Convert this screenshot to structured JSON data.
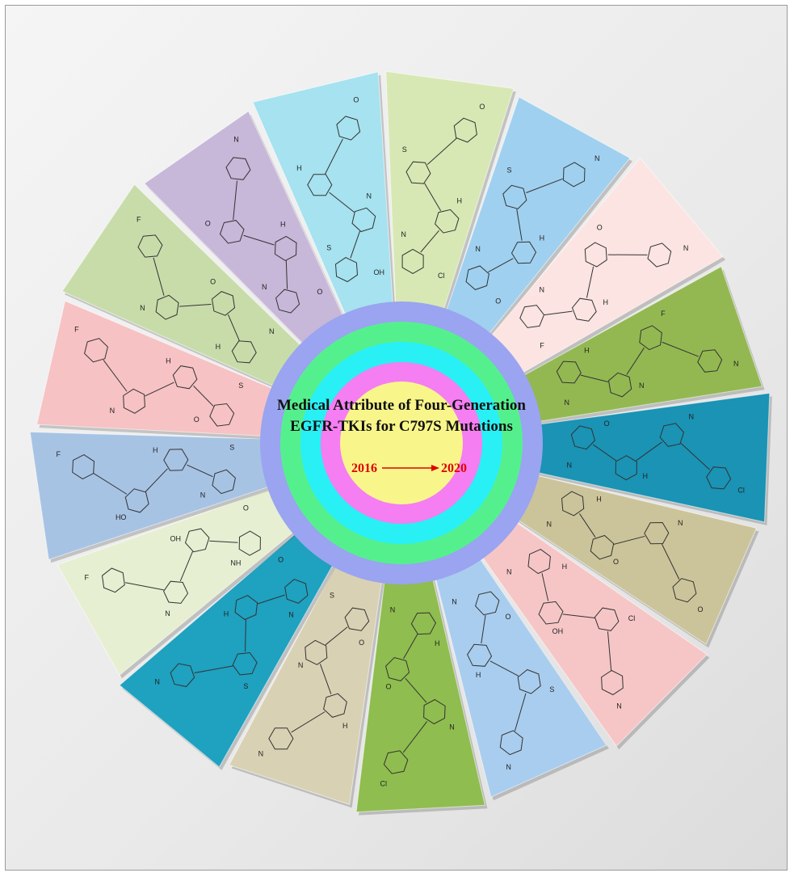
{
  "center": {
    "title_line1": "Medical Attribute of Four-Generation",
    "title_line2": "EGFR-TKIs for C797S Mutations",
    "year_start": "2016",
    "year_end": "2020",
    "arrow_color": "#e10000"
  },
  "rings": {
    "colors": [
      "#9aa4f0",
      "#55f08e",
      "#28f0f5",
      "#f47ef2",
      "#f8f68a"
    ]
  },
  "wedges": [
    {
      "name": "wedge-1",
      "color": "#d7e8b4",
      "atoms": [
        "Cl",
        "N",
        "H",
        "S",
        "O"
      ]
    },
    {
      "name": "wedge-2",
      "color": "#9fd0ef",
      "atoms": [
        "O",
        "N",
        "H",
        "S",
        "N"
      ]
    },
    {
      "name": "wedge-3",
      "color": "#fbe4e2",
      "atoms": [
        "F",
        "N",
        "H",
        "O",
        "N"
      ]
    },
    {
      "name": "wedge-4",
      "color": "#93b852",
      "atoms": [
        "N",
        "H",
        "N",
        "F",
        "N"
      ]
    },
    {
      "name": "wedge-5",
      "color": "#1a93b4",
      "atoms": [
        "N",
        "O",
        "H",
        "N",
        "Cl"
      ]
    },
    {
      "name": "wedge-6",
      "color": "#cbc49a",
      "atoms": [
        "N",
        "H",
        "O",
        "N",
        "O"
      ]
    },
    {
      "name": "wedge-7",
      "color": "#f6c6c6",
      "atoms": [
        "N",
        "H",
        "OH",
        "Cl",
        "N"
      ]
    },
    {
      "name": "wedge-8",
      "color": "#a9cdee",
      "atoms": [
        "N",
        "O",
        "H",
        "S",
        "N"
      ]
    },
    {
      "name": "wedge-9",
      "color": "#8fbd4f",
      "atoms": [
        "N",
        "H",
        "O",
        "N",
        "Cl"
      ]
    },
    {
      "name": "wedge-10",
      "color": "#d9d1b4",
      "atoms": [
        "S",
        "O",
        "N",
        "H",
        "N"
      ]
    },
    {
      "name": "wedge-11",
      "color": "#1fa1c0",
      "atoms": [
        "O",
        "N",
        "H",
        "S",
        "N"
      ]
    },
    {
      "name": "wedge-12",
      "color": "#e6efd2",
      "atoms": [
        "O",
        "NH",
        "OH",
        "N",
        "F"
      ]
    },
    {
      "name": "wedge-13",
      "color": "#a7c3e4",
      "atoms": [
        "S",
        "N",
        "H",
        "HO",
        "F"
      ]
    },
    {
      "name": "wedge-14",
      "color": "#f6c2c4",
      "atoms": [
        "S",
        "O",
        "H",
        "N",
        "F"
      ]
    },
    {
      "name": "wedge-15",
      "color": "#c8dcaa",
      "atoms": [
        "N",
        "H",
        "O",
        "N",
        "F"
      ]
    },
    {
      "name": "wedge-16",
      "color": "#c7b7d9",
      "atoms": [
        "O",
        "N",
        "H",
        "O",
        "N"
      ]
    },
    {
      "name": "wedge-17",
      "color": "#a6e2ef",
      "atoms": [
        "OH",
        "S",
        "N",
        "H",
        "O"
      ]
    }
  ]
}
